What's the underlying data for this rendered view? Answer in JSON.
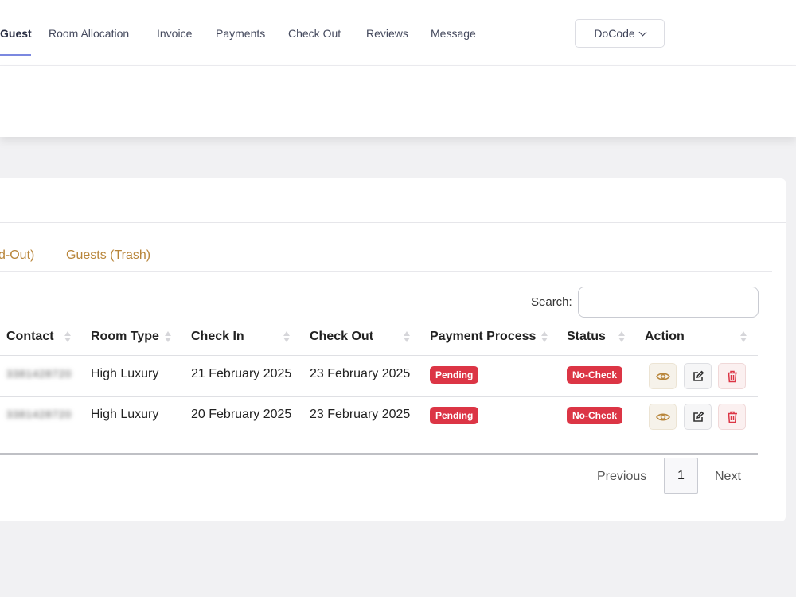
{
  "nav": {
    "items": [
      {
        "label": "Guest",
        "active": true
      },
      {
        "label": "Room Allocation"
      },
      {
        "label": "Invoice"
      },
      {
        "label": "Payments"
      },
      {
        "label": "Check Out"
      },
      {
        "label": "Reviews"
      },
      {
        "label": "Message"
      }
    ],
    "company": "DoCode"
  },
  "tabs": [
    "d-Out)",
    "Guests (Trash)"
  ],
  "search": {
    "label": "Search:",
    "value": ""
  },
  "table": {
    "headers": [
      "Contact",
      "Room Type",
      "Check In",
      "Check Out",
      "Payment Process",
      "Status",
      "Action"
    ],
    "rows": [
      {
        "contact": "3381428720",
        "room_type": "High Luxury",
        "check_in": "21 February 2025",
        "check_out": "23 February 2025",
        "payment": "Pending",
        "status": "No-Check"
      },
      {
        "contact": "3381428720",
        "room_type": "High Luxury",
        "check_in": "20 February 2025",
        "check_out": "23 February 2025",
        "payment": "Pending",
        "status": "No-Check"
      }
    ]
  },
  "pagination": {
    "previous": "Previous",
    "page": "1",
    "next": "Next"
  },
  "colors": {
    "accent_tab": "#b8853a",
    "badge": "#dc3545",
    "nav_underline": "#7b88e0"
  }
}
